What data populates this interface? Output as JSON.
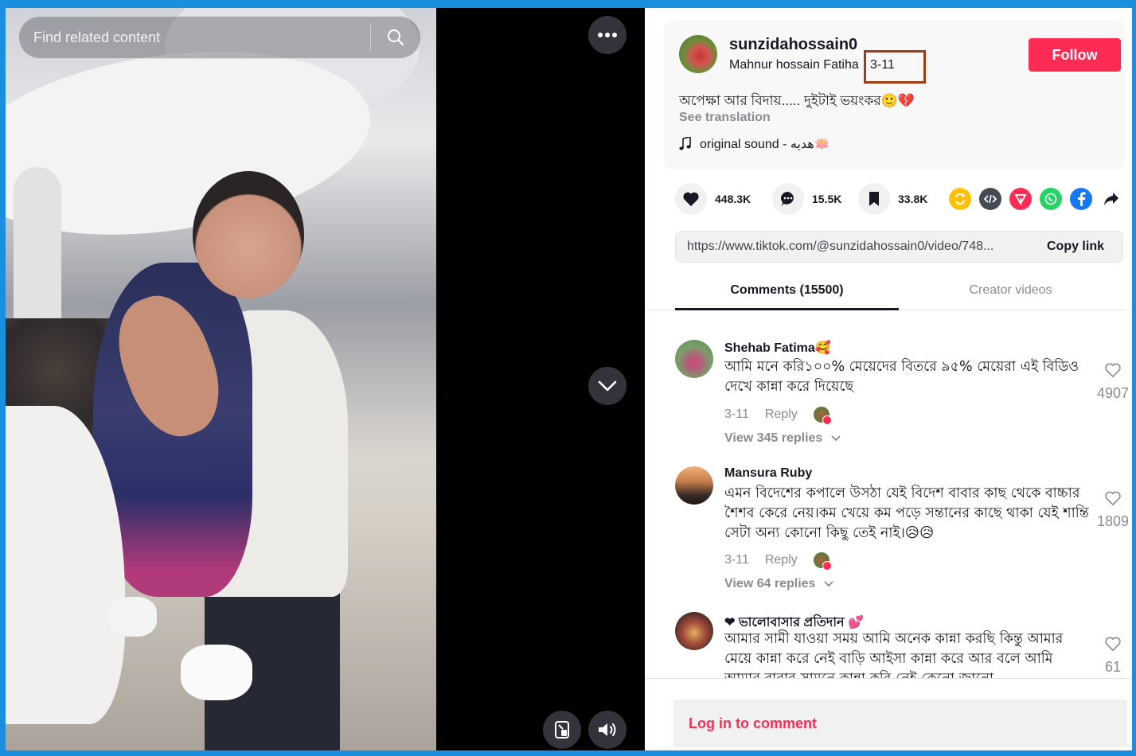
{
  "search": {
    "placeholder": "Find related content"
  },
  "video_controls": {
    "more_icon": "ellipsis-icon",
    "down_icon": "chevron-down-icon",
    "pip_icon": "floating-player-icon",
    "volume_icon": "speaker-icon"
  },
  "post": {
    "username": "sunzidahossain0",
    "display_name": "Mahnur hossain Fatiha",
    "separator": " · ",
    "date": "3-11",
    "follow_label": "Follow",
    "caption": "অপেক্ষা আর বিদায়..... দুইটাই ভয়ংকর🙂💔",
    "see_translation": "See translation",
    "sound": "original sound - هديه🪷"
  },
  "actions": {
    "likes": "448.3K",
    "comments": "15.5K",
    "saves": "33.8K",
    "share_icons": [
      "repost-icon",
      "embed-icon",
      "send-to-friends-icon",
      "whatsapp-icon",
      "facebook-icon",
      "share-arrow-icon"
    ]
  },
  "link": {
    "url": "https://www.tiktok.com/@sunzidahossain0/video/748...",
    "copy_label": "Copy link"
  },
  "tabs": {
    "comments": "Comments (15500)",
    "creator": "Creator videos"
  },
  "comments": [
    {
      "name": "Shehab Fatima🥰",
      "text": "আমি মনে করি১০০% মেয়েদের বিতরে ৯৫% মেয়েরা এই বিডিও দেখে কান্না করে দিয়েছে",
      "date": "3-11",
      "reply": "Reply",
      "view_replies": "View 345 replies",
      "likes": "4907"
    },
    {
      "name": "Mansura Ruby",
      "text": "এমন বিদেশের কপালে উসঠা যেই বিদেশ বাবার কাছ থেকে বাচ্চার শৈশব কেরে নেয়।কম খেয়ে কম পড়ে সন্তানের কাছে থাকা যেই শান্তি সেটা অন্য কোনো কিছু তেই নাই।😥😥",
      "date": "3-11",
      "reply": "Reply",
      "view_replies": "View 64 replies",
      "likes": "1809"
    },
    {
      "name": "❤ ভালোবাসার প্রতিদান 💕",
      "text": "আমার সামী যাওয়া সময় আমি অনেক কান্না করছি কিন্তু আমার মেয়ে কান্না করে নেই বাড়ি আইসা কান্না করে আর বলে আমি আমার বাবার সামনে কান্না করি নেই কেনো জানো",
      "likes": "61"
    }
  ],
  "login": {
    "label": "Log in to comment"
  },
  "colors": {
    "accent": "#fe2c55",
    "highlight_box": "#a23a13",
    "page_border": "#1a8fe0"
  }
}
